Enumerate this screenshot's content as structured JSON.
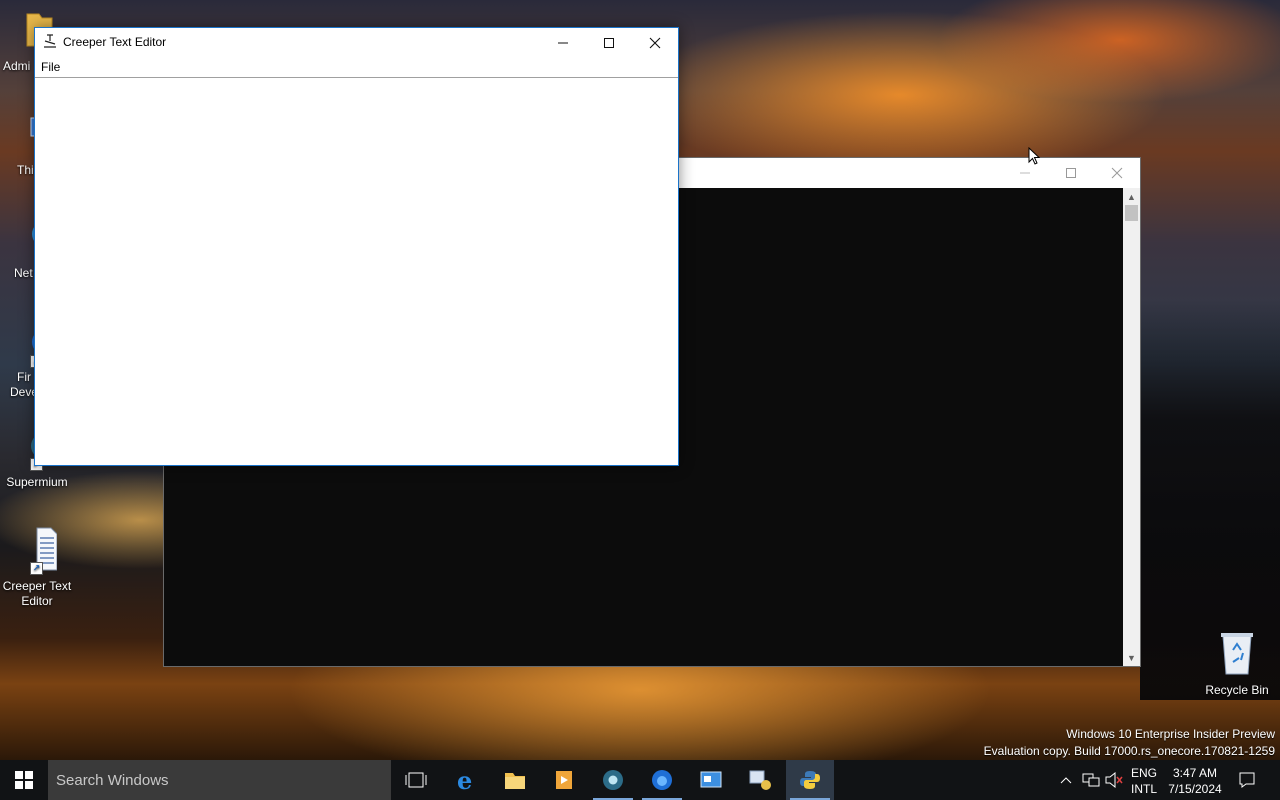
{
  "desktop": {
    "icons": [
      {
        "label": "Admi"
      },
      {
        "label": "Thi"
      },
      {
        "label": "Net"
      },
      {
        "label": "Fir\nDeve"
      },
      {
        "label": "Supermium"
      },
      {
        "label": "Creeper Text\nEditor"
      },
      {
        "label": "Recycle Bin"
      }
    ],
    "watermark_line1": "Windows 10 Enterprise Insider Preview",
    "watermark_line2": "Evaluation copy. Build 17000.rs_onecore.170821-1259"
  },
  "editor": {
    "title": "Creeper Text Editor",
    "menu_file": "File",
    "content": ""
  },
  "console": {
    "content": ""
  },
  "taskbar": {
    "search_placeholder": "Search Windows",
    "lang_line1": "ENG",
    "lang_line2": "INTL",
    "time": "3:47 AM",
    "date": "7/15/2024",
    "pinned": [
      "task-view-icon",
      "edge-icon",
      "file-explorer-icon",
      "media-player-icon",
      "supermium-icon",
      "firefox-icon",
      "control-panel-icon",
      "network-share-icon",
      "python-icon"
    ]
  },
  "colors": {
    "taskbar_bg": "#111315",
    "editor_border": "#1a73c9",
    "console_bg": "#0c0c0c"
  }
}
